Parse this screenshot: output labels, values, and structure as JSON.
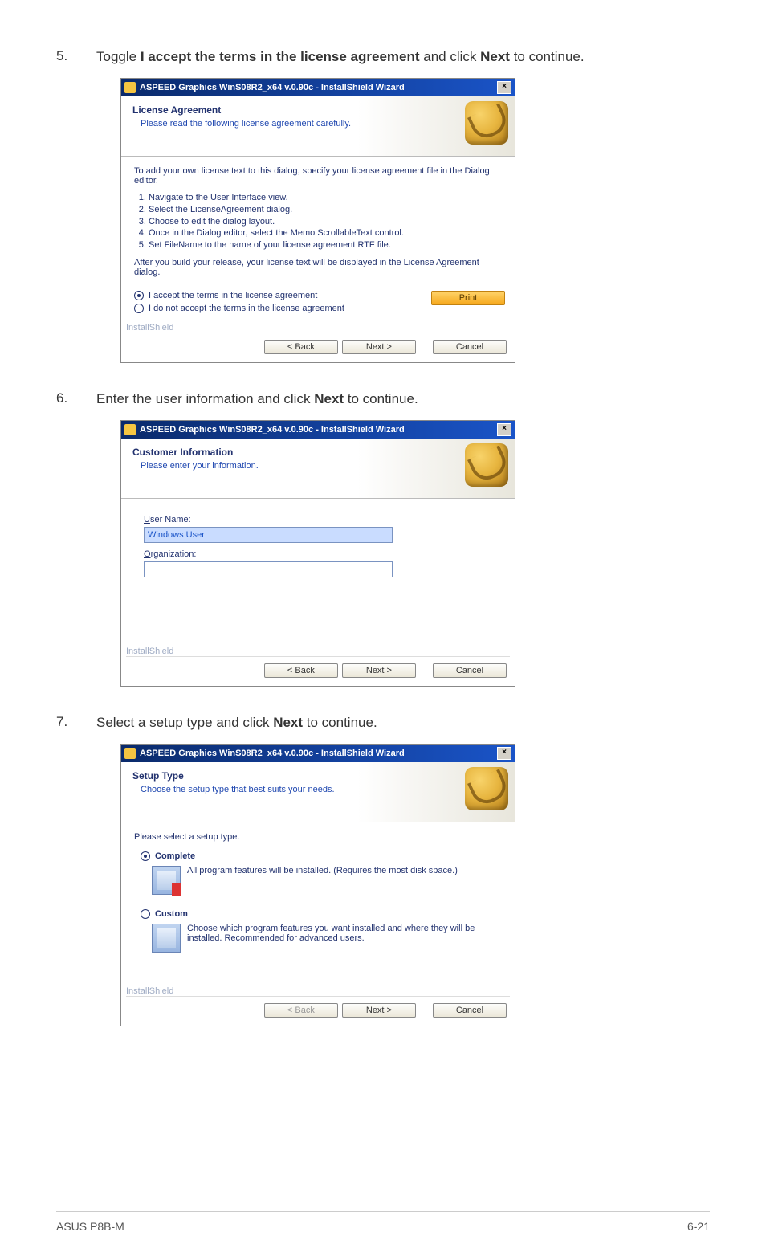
{
  "steps": {
    "s5": {
      "num": "5.",
      "text_a": "Toggle ",
      "bold_a": "I accept the terms in the license agreement",
      "text_b": " and click ",
      "bold_b": "Next",
      "text_c": " to continue."
    },
    "s6": {
      "num": "6.",
      "text_a": "Enter the user information and click ",
      "bold_a": "Next",
      "text_b": " to continue."
    },
    "s7": {
      "num": "7.",
      "text_a": "Select a setup type and click ",
      "bold_a": "Next",
      "text_b": " to continue."
    }
  },
  "dlg1": {
    "title": "ASPEED Graphics WinS08R2_x64 v.0.90c - InstallShield Wizard",
    "h_title": "License Agreement",
    "h_sub": "Please read the following license agreement carefully.",
    "intro": "To add your own license text to this dialog, specify your license agreement file in the Dialog editor.",
    "list": [
      "Navigate to the User Interface view.",
      "Select the LicenseAgreement dialog.",
      "Choose to edit the dialog layout.",
      "Once in the Dialog editor, select the Memo ScrollableText control.",
      "Set FileName to the name of your license agreement RTF file."
    ],
    "outro": "After you build your release, your license text will be displayed in the License Agreement dialog.",
    "radio_accept": "I accept the terms in the license agreement",
    "radio_reject": "I do not accept the terms in the license agreement",
    "brand": "InstallShield",
    "btn_print": "Print",
    "btn_back": "< Back",
    "btn_next": "Next >",
    "btn_cancel": "Cancel"
  },
  "dlg2": {
    "title": "ASPEED Graphics WinS08R2_x64 v.0.90c - InstallShield Wizard",
    "h_title": "Customer Information",
    "h_sub": "Please enter your information.",
    "lbl_user_u": "U",
    "lbl_user": "ser Name:",
    "val_user": "Windows User",
    "lbl_org_u": "O",
    "lbl_org": "rganization:",
    "brand": "InstallShield",
    "btn_back": "< Back",
    "btn_next": "Next >",
    "btn_cancel": "Cancel"
  },
  "dlg3": {
    "title": "ASPEED Graphics WinS08R2_x64 v.0.90c - InstallShield Wizard",
    "h_title": "Setup Type",
    "h_sub": "Choose the setup type that best suits your needs.",
    "prompt": "Please select a setup type.",
    "opt_complete": "Complete",
    "opt_complete_desc": "All program features will be installed. (Requires the most disk space.)",
    "opt_custom": "Custom",
    "opt_custom_desc": "Choose which program features you want installed and where they will be installed. Recommended for advanced users.",
    "brand": "InstallShield",
    "btn_back": "< Back",
    "btn_next": "Next >",
    "btn_cancel": "Cancel"
  },
  "footer": {
    "left": "ASUS P8B-M",
    "right": "6-21"
  }
}
